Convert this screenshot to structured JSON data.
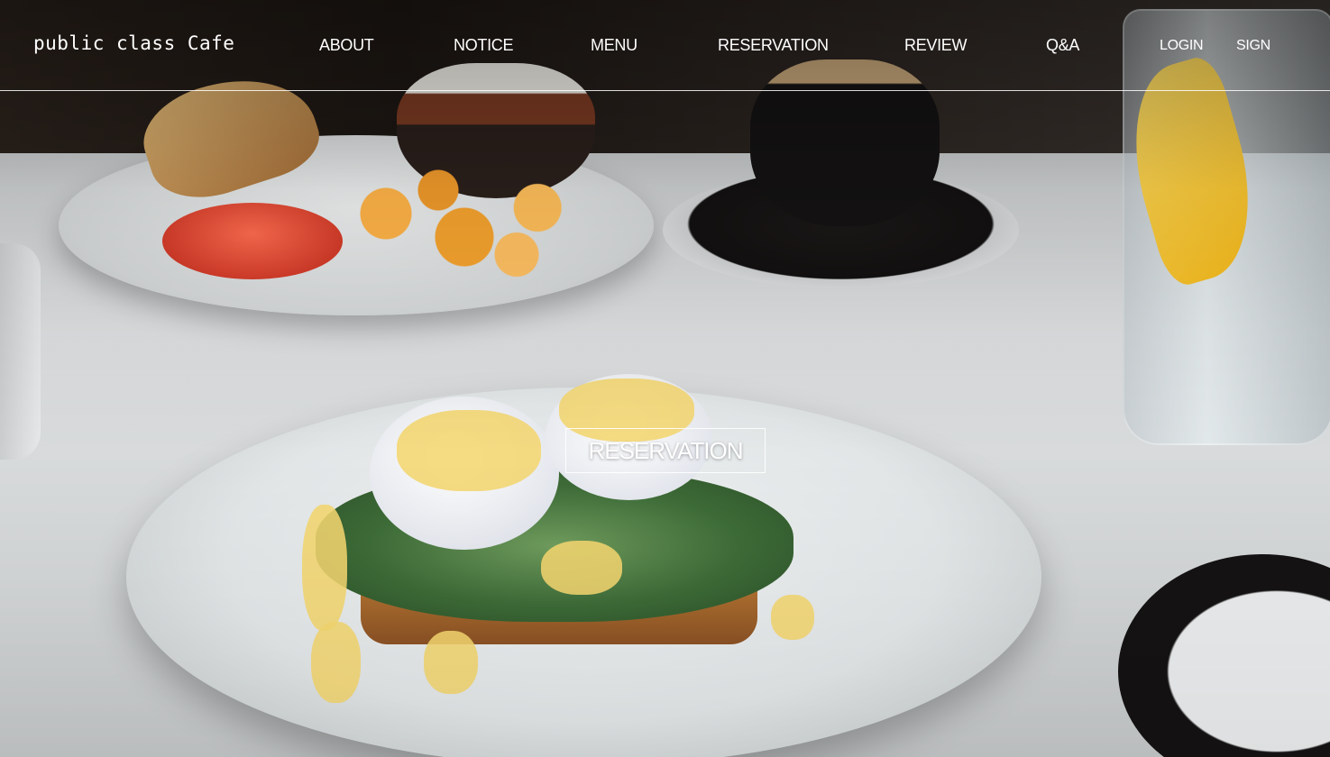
{
  "header": {
    "logo": "public class Cafe",
    "nav": {
      "about": "ABOUT",
      "notice": "NOTICE",
      "menu": "MENU",
      "reservation": "RESERVATION",
      "review": "REVIEW",
      "qna": "Q&A"
    },
    "auth": {
      "login": "LOGIN",
      "sign": "SIGN"
    }
  },
  "hero": {
    "cta_label": "RESERVATION",
    "background_image": "cafe-brunch-eggs-benedict-photo"
  },
  "colors": {
    "text": "#ffffff",
    "divider": "#ffffff"
  }
}
